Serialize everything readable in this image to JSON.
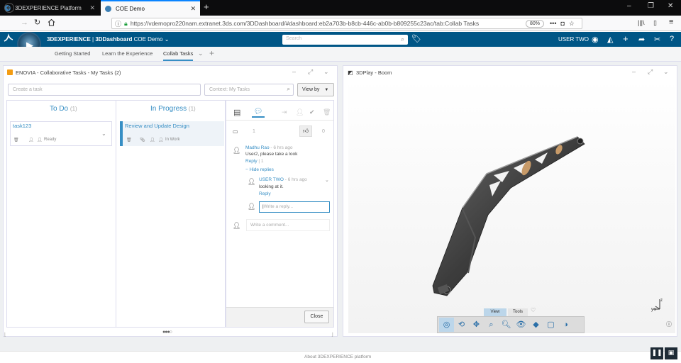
{
  "browser": {
    "tabs": [
      {
        "title": "3DEXPERIENCE Platform",
        "close": "✕",
        "favicon_color": "#3b7fb5"
      },
      {
        "title": "COE Demo",
        "close": "✕",
        "favicon_color": "#3b7fb5"
      }
    ],
    "new_tab": "+",
    "url": "https://vdemopro220nam.extranet.3ds.com/3DDashboard/#dashboard:eb2a703b-b8cb-446c-ab0b-b809255c23ac/tab:Collab Tasks",
    "zoom": "80%",
    "window_controls": [
      "–",
      "❐",
      "✕"
    ]
  },
  "header": {
    "brand": "3DEXPERIENCE",
    "separator": " | ",
    "app": "3DDashboard",
    "dashboard": "COE Demo",
    "chevron": "⌄",
    "search_placeholder": "Search",
    "user": "USER TWO",
    "accent": "#005686"
  },
  "dashboard_tabs": [
    "Getting Started",
    "Learn the Experience",
    "Collab Tasks"
  ],
  "left_widget": {
    "title": "ENOVIA - Collaborative Tasks - My Tasks (2)",
    "create_placeholder": "Create a task",
    "context_placeholder": "Context: My Tasks",
    "view_by": "View by",
    "columns": [
      {
        "title": "To Do",
        "count": "(1)"
      },
      {
        "title": "In Progress",
        "count": "(1)"
      }
    ],
    "cards": [
      {
        "title": "task123",
        "status": "Ready"
      },
      {
        "title": "Review and Update Design",
        "status": "In Work"
      }
    ],
    "detail": {
      "comments_count": "1",
      "likes_count": "0",
      "comment1": {
        "author": "Madhu Rao",
        "time": " - 6 hrs ago",
        "text": "User2, please take a look",
        "reply": "Reply",
        "reply_count": " | 1",
        "hide": "− Hide replies"
      },
      "comment2": {
        "author": "USER TWO",
        "time": " - 6 hrs ago",
        "text": "looking at it.",
        "reply": "Reply"
      },
      "reply_placeholder": "Write a reply...",
      "comment_placeholder": "Write a comment...",
      "close": "Close"
    },
    "pager": "●●●○"
  },
  "right_widget": {
    "title": "3DPlay - Boom",
    "toolbar_tabs": [
      "View",
      "Tools"
    ],
    "axis_z": "z",
    "axis_y": "y",
    "axis_x": "x"
  },
  "footer": {
    "text": "About 3DEXPERIENCE platform"
  }
}
